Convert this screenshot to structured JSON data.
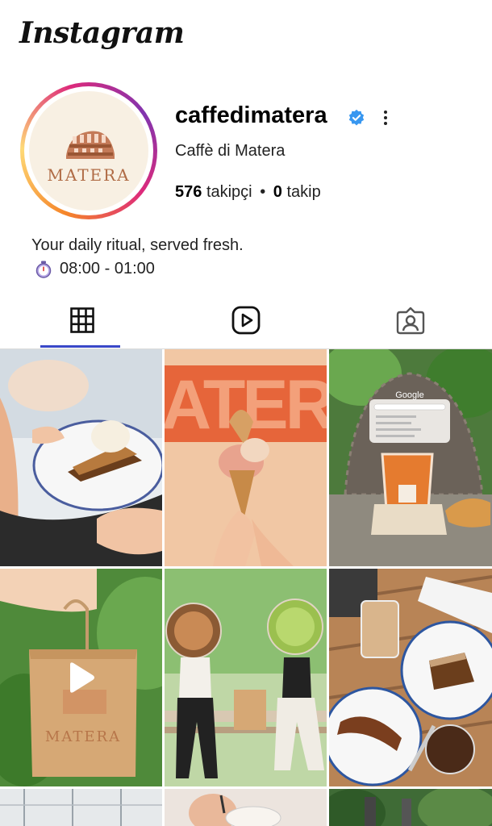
{
  "app": {
    "logo": "Instagram"
  },
  "profile": {
    "username": "caffedimatera",
    "full_name": "Caffè di Matera",
    "followers_count": "576",
    "followers_label": "takipçi",
    "separator": "•",
    "following_count": "0",
    "following_label": "takip",
    "avatar_wordmark": "MATERA",
    "bio_line1": "Your daily ritual, served fresh.",
    "bio_hours": "08:00 - 01:00"
  },
  "tabs": [
    {
      "name": "posts-grid",
      "icon": "grid-icon",
      "active": true
    },
    {
      "name": "reels",
      "icon": "reels-icon",
      "active": false
    },
    {
      "name": "tagged",
      "icon": "tagged-person-icon",
      "active": false
    }
  ],
  "posts": [
    {
      "desc": "cake-slice-with-ice-cream"
    },
    {
      "desc": "gelato-cone-in-front-of-sign"
    },
    {
      "desc": "iced-latte-and-croissant",
      "overlay_text": "Google"
    },
    {
      "desc": "matera-paper-bag",
      "is_video": true,
      "bag_text": "MATERA"
    },
    {
      "desc": "people-on-bench-with-iced-drinks"
    },
    {
      "desc": "coffee-table-with-desserts"
    },
    {
      "desc": "post-row3-a"
    },
    {
      "desc": "post-row3-b"
    },
    {
      "desc": "post-row3-c"
    }
  ],
  "colors": {
    "verified": "#3897f0",
    "active_tab_underline": "#3a48c8",
    "brand_orange": "#e8703a"
  }
}
